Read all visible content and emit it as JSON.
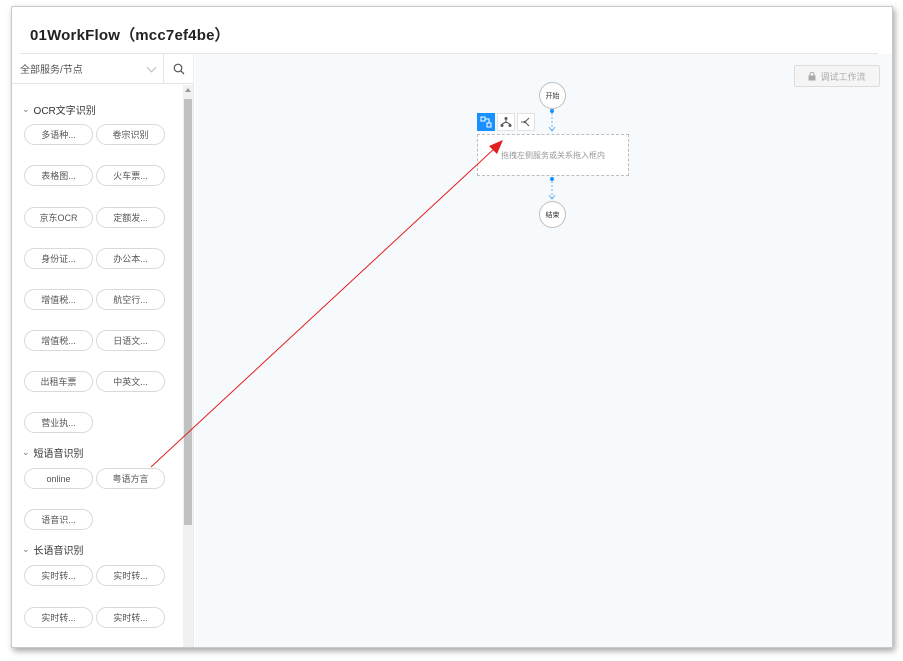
{
  "window": {
    "title": "01WorkFlow（mcc7ef4be）"
  },
  "sidebar": {
    "search_select_value": "全部服务/节点",
    "groups": [
      {
        "label": "OCR文字识别",
        "items": [
          "多语种...",
          "卷宗识别",
          "表格图...",
          "火车票...",
          "京东OCR",
          "定额发...",
          "身份证...",
          "办公本...",
          "增值税...",
          "航空行...",
          "增值税...",
          "日语文...",
          "出租车票",
          "中英文...",
          "营业执..."
        ]
      },
      {
        "label": "短语音识别",
        "items": [
          "online",
          "粤语方言",
          "语音识..."
        ]
      },
      {
        "label": "长语音识别",
        "items": [
          "实时转...",
          "实时转...",
          "实时转...",
          "实时转..."
        ]
      }
    ]
  },
  "canvas": {
    "debug_button": "调试工作流",
    "start_node": "开始",
    "end_node": "结束",
    "drop_hint": "拖拽左侧服务或关系拖入框内"
  },
  "colors": {
    "accent": "#1890ff",
    "arrow": "#e02020"
  }
}
